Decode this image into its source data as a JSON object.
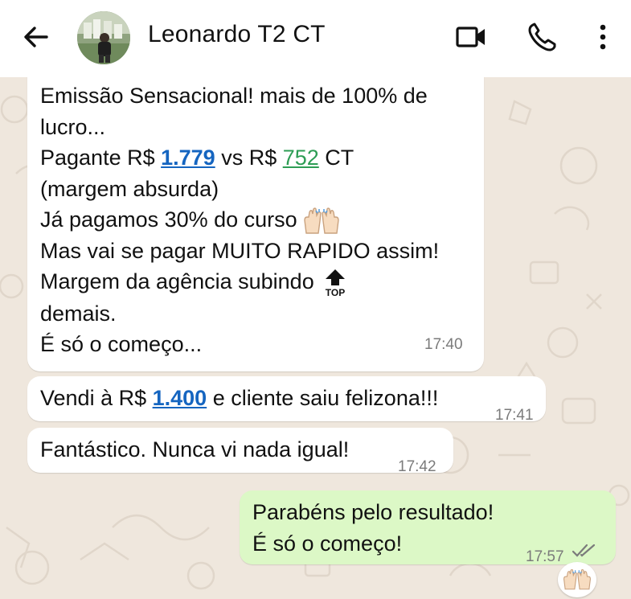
{
  "header": {
    "contact_name": "Leonardo T2 CT",
    "icons": [
      "back-arrow-icon",
      "video-call-icon",
      "phone-icon",
      "more-vert-icon"
    ]
  },
  "messages": [
    {
      "direction": "incoming",
      "time": "17:40",
      "lines": {
        "l1": "Emissão Sensacional! mais de 100% de",
        "l2": "lucro...",
        "l3_a": "Pagante R$ ",
        "l3_v1": "1.779",
        "l3_b": " vs R$ ",
        "l3_v2": "752",
        "l3_c": " CT",
        "l4": "(margem absurda)",
        "l5": "Já pagamos 30% do curso",
        "l6": "Mas vai se pagar MUITO RAPIDO assim!",
        "l7": "Margem da agência subindo",
        "l8": "demais.",
        "l9": "É só o começo..."
      },
      "emojis": [
        "raising-hands-emoji",
        "top-arrow-emoji"
      ],
      "top_emoji_text": "TOP"
    },
    {
      "direction": "incoming",
      "time": "17:41",
      "parts": {
        "a": "Vendi à R$ ",
        "v": "1.400",
        "b": " e cliente saiu felizona!!!"
      }
    },
    {
      "direction": "incoming",
      "time": "17:42",
      "text": "Fantástico. Nunca vi nada igual!"
    },
    {
      "direction": "outgoing",
      "time": "17:57",
      "line1": "Parabéns pelo resultado!",
      "line2": "É só o começo!",
      "status": "read-double-check-icon",
      "reaction": "raising-hands-emoji"
    }
  ],
  "colors": {
    "link_blue": "#1565c0",
    "link_green": "#2e9d55",
    "outgoing_bubble": "#dcf8c6",
    "chat_background": "#efe7dd"
  }
}
